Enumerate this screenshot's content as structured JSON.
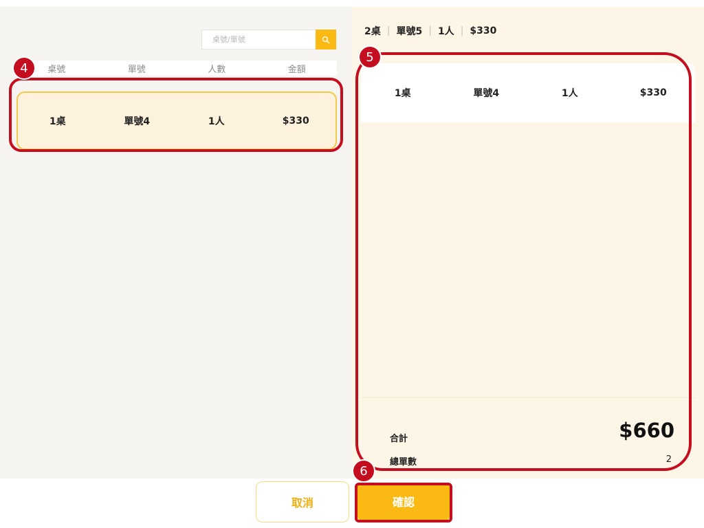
{
  "search": {
    "placeholder": "桌號/單號",
    "button_icon": "search-icon"
  },
  "order_list": {
    "columns": [
      "桌號",
      "單號",
      "人數",
      "金額"
    ],
    "rows": [
      {
        "table": "1桌",
        "order_no": "單號4",
        "guests": "1人",
        "amount": "$330"
      }
    ]
  },
  "current_order": {
    "table": "2桌",
    "order_no": "單號5",
    "guests": "1人",
    "amount": "$330"
  },
  "merge_panel": {
    "selected": [
      {
        "table": "1桌",
        "order_no": "單號4",
        "guests": "1人",
        "amount": "$330"
      }
    ],
    "total_label": "合計",
    "total_value": "$660",
    "count_label": "總單數",
    "count_value": "2"
  },
  "actions": {
    "cancel_label": "取消",
    "confirm_label": "確認"
  },
  "annotations": {
    "step_4": "4",
    "step_5": "5",
    "step_6": "6"
  },
  "colors": {
    "accent": "#fbb913",
    "annotation": "#c40d1f",
    "left_bg": "#f6f4f0",
    "right_bg": "#fdf5e6",
    "row_selected_bg": "#fdf2dc"
  }
}
